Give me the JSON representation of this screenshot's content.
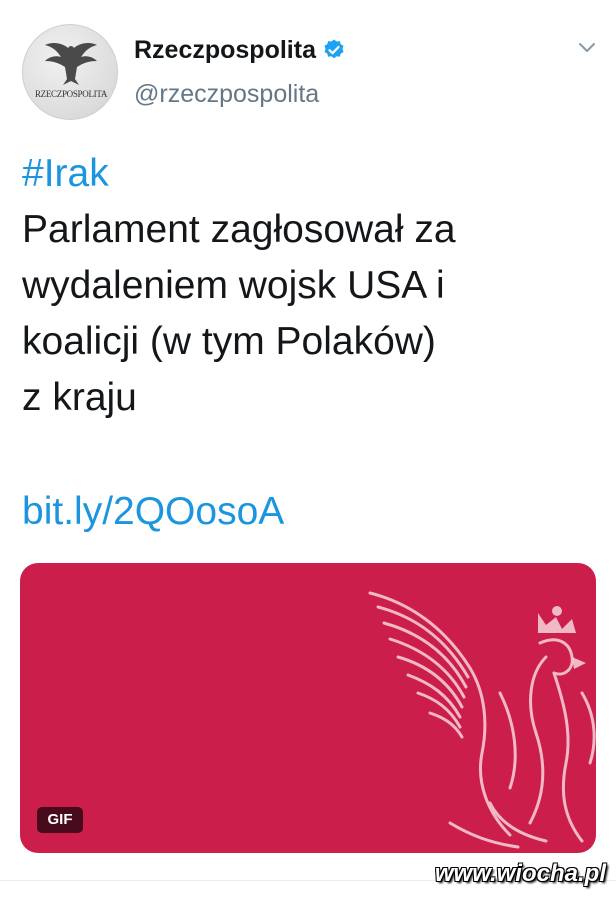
{
  "account": {
    "display_name": "Rzeczpospolita",
    "handle": "@rzeczpospolita",
    "avatar_text": "RZECZPOSPOLITA",
    "verified": true
  },
  "tweet": {
    "hashtag": "#Irak",
    "lines": [
      "Parlament zagłosował za",
      "wydaleniem wojsk USA i",
      "koalicji (w tym Polaków)",
      "z kraju"
    ],
    "link": "bit.ly/2QOosoA"
  },
  "media": {
    "badge": "GIF",
    "background_color": "#cc1e4b"
  },
  "watermark": "www.wiocha.pl",
  "colors": {
    "link": "#1b95e0",
    "handle": "#657786",
    "verified": "#1da1f2"
  }
}
